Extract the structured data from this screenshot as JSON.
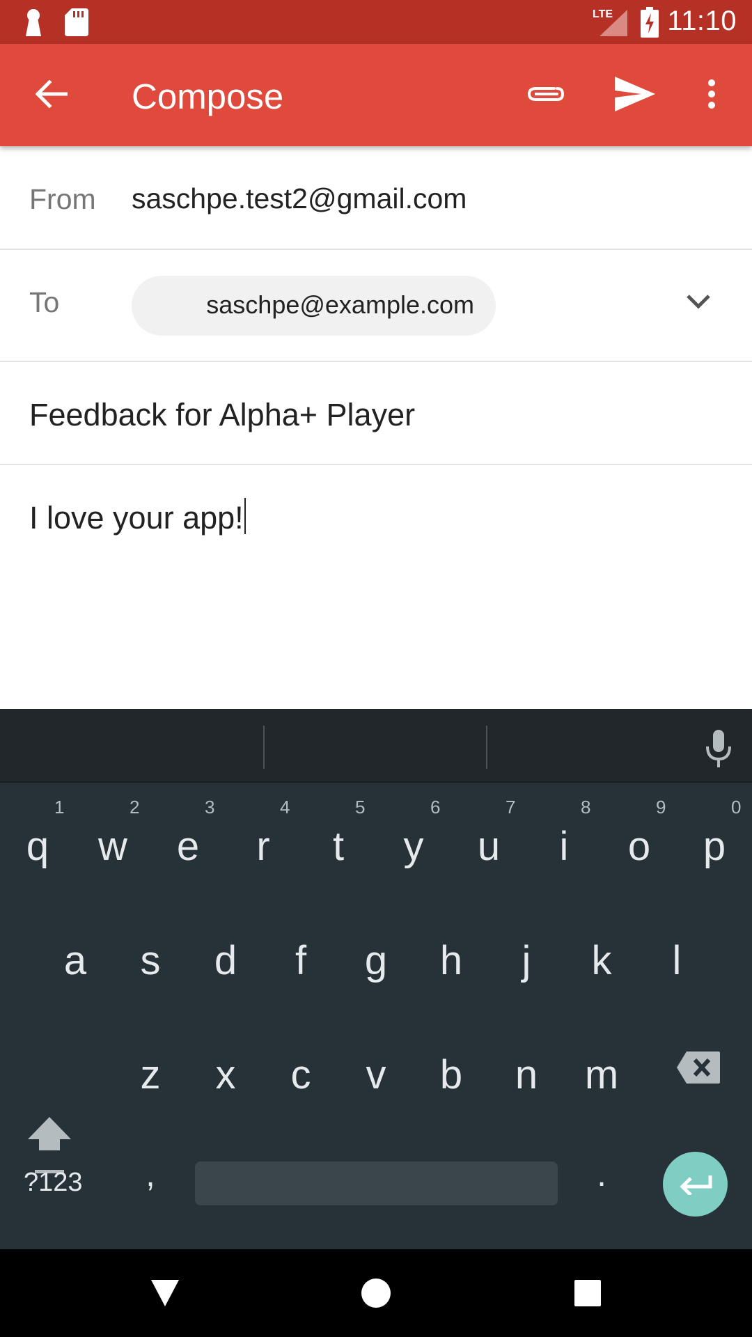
{
  "status_bar": {
    "network_label": "LTE",
    "time": "11:10",
    "left_icons": [
      "keyhole-icon",
      "sd-card-icon"
    ],
    "right_icons": [
      "signal-icon",
      "battery-charging-icon"
    ]
  },
  "app_bar": {
    "title": "Compose",
    "icons": [
      "back-arrow-icon",
      "paperclip-icon",
      "send-icon",
      "overflow-menu-icon"
    ],
    "color": "#df4a3d",
    "status_color": "#b53126"
  },
  "compose": {
    "from_label": "From",
    "from_value": "saschpe.test2@gmail.com",
    "to_label": "To",
    "to_chip": "saschpe@example.com",
    "subject": "Feedback for Alpha+ Player",
    "body": "I love your app!"
  },
  "keyboard": {
    "row1": [
      "q",
      "w",
      "e",
      "r",
      "t",
      "y",
      "u",
      "i",
      "o",
      "p"
    ],
    "row1_hints": [
      "1",
      "2",
      "3",
      "4",
      "5",
      "6",
      "7",
      "8",
      "9",
      "0"
    ],
    "row2": [
      "a",
      "s",
      "d",
      "f",
      "g",
      "h",
      "j",
      "k",
      "l"
    ],
    "row3": [
      "z",
      "x",
      "c",
      "v",
      "b",
      "n",
      "m"
    ],
    "symbols_key": "?123",
    "comma_key": ",",
    "period_key": ".",
    "background": "#263238",
    "enter_color": "#7fcdc3"
  },
  "nav_bar": {
    "icons": [
      "back-triangle-icon",
      "home-circle-icon",
      "recents-square-icon"
    ]
  }
}
